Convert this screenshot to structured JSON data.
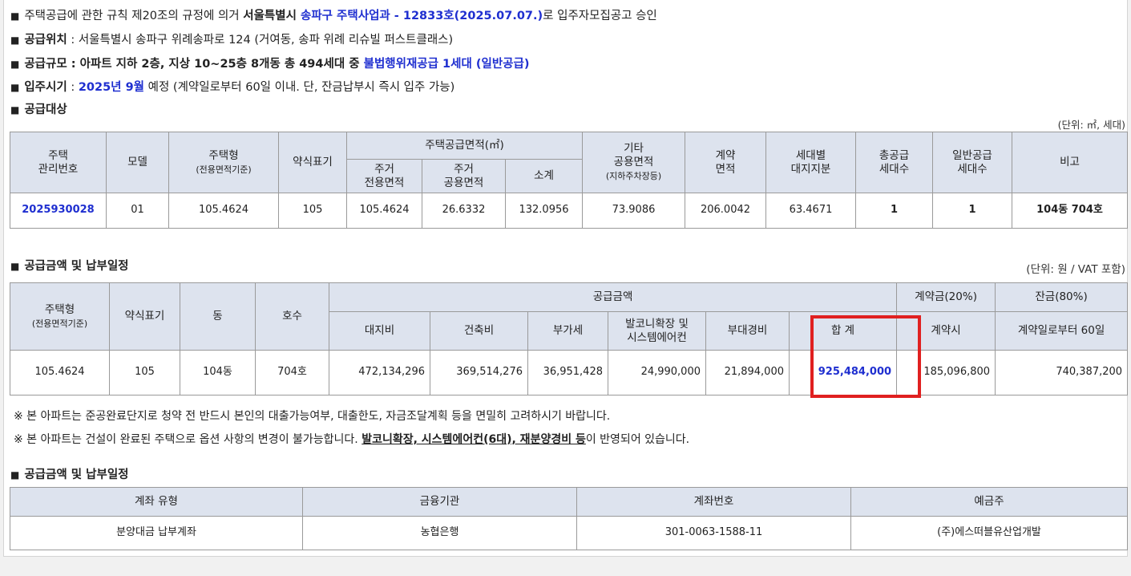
{
  "intro": {
    "l1_a": "주택공급에 관한 규칙 제20조의 규정에 의거 ",
    "l1_b": "서울특별시 ",
    "l1_c": "송파구 주택사업과 - 12833호(2025.07.07.)",
    "l1_d": "로 입주자모집공고 승인",
    "l2_label": "공급위치",
    "l2_text": " : 서울특별시 송파구 위례송파로 124 (거여동, 송파 위례 리슈빌 퍼스트클래스)",
    "l3_label": "공급규모",
    "l3_a": " : 아파트 지하 2층, 지상 10~25층 8개동 총 494세대 중 ",
    "l3_b": "불법행위재공급 1세대 (일반공급)",
    "l4_label": "입주시기",
    "l4_sep": " : ",
    "l4_a": "2025년 9월",
    "l4_b": " 예정 (계약일로부터 60일 이내. 단, 잔금납부시 즉시 입주 가능)",
    "l5_label": "공급대상"
  },
  "bullet": "■",
  "supply_unit": "(단위: ㎡, 세대)",
  "supply_table": {
    "h_house_no_1": "주택",
    "h_house_no_2": "관리번호",
    "h_model": "모델",
    "h_type": "주택형",
    "h_type_sub": "(전용면적기준)",
    "h_label": "약식표기",
    "h_area": "주택공급면적(㎡)",
    "h_res_1": "주거",
    "h_res_2": "전용면적",
    "h_common_1": "주거",
    "h_common_2": "공용면적",
    "h_subtotal": "소계",
    "h_other_1": "기타",
    "h_other_2": "공용면적",
    "h_other_sub": "(지하주차장등)",
    "h_contract_1": "계약",
    "h_contract_2": "면적",
    "h_land_1": "세대별",
    "h_land_2": "대지지분",
    "h_total_1": "총공급",
    "h_total_2": "세대수",
    "h_general_1": "일반공급",
    "h_general_2": "세대수",
    "h_note": "비고",
    "row": {
      "house_no": "2025930028",
      "model": "01",
      "type": "105.4624",
      "label": "105",
      "res": "105.4624",
      "common": "26.6332",
      "subtotal": "132.0956",
      "other": "73.9086",
      "contract": "206.0042",
      "land": "63.4671",
      "total": "1",
      "general": "1",
      "note": "104동 704호"
    }
  },
  "price_title": "공급금액 및 납부일정",
  "price_unit": "(단위: 원 / VAT 포함)",
  "price_table": {
    "h_type": "주택형",
    "h_type_sub": "(전용면적기준)",
    "h_label": "약식표기",
    "h_dong": "동",
    "h_ho": "호수",
    "h_amount": "공급금액",
    "h_land": "대지비",
    "h_build": "건축비",
    "h_vat": "부가세",
    "h_balcony_1": "발코니확장 및",
    "h_balcony_2": "시스템에어컨",
    "h_extra": "부대경비",
    "h_sum": "합 계",
    "h_deposit": "계약금(20%)",
    "h_deposit_sub": "계약시",
    "h_balance": "잔금(80%)",
    "h_balance_sub": "계약일로부터 60일",
    "row": {
      "type": "105.4624",
      "label": "105",
      "dong": "104동",
      "ho": "704호",
      "land": "472,134,296",
      "build": "369,514,276",
      "vat": "36,951,428",
      "balcony": "24,990,000",
      "extra": "21,894,000",
      "sum": "925,484,000",
      "deposit": "185,096,800",
      "balance": "740,387,200"
    }
  },
  "notes": {
    "n1": "※ 본 아파트는 준공완료단지로 청약 전 반드시 본인의 대출가능여부, 대출한도, 자금조달계획 등을 면밀히 고려하시기 바랍니다.",
    "n2_a": "※ 본 아파트는 건설이 완료된 주택으로 옵션 사항의 변경이 불가능합니다. ",
    "n2_b": "발코니확장, 시스템에어컨(6대), 재분양경비 등",
    "n2_c": "이 반영되어 있습니다."
  },
  "account_title": "공급금액 및 납부일정",
  "account_table": {
    "h_type": "계좌 유형",
    "h_bank": "금융기관",
    "h_no": "계좌번호",
    "h_holder": "예금주",
    "row": {
      "type": "분양대금 납부계좌",
      "bank": "농협은행",
      "no": "301-0063-1588-11",
      "holder": "(주)에스떠블유산업개발"
    }
  },
  "colors": {
    "blue": "#1f2fd0",
    "highlight": "#e02020",
    "header_bg": "#dde3ee"
  }
}
